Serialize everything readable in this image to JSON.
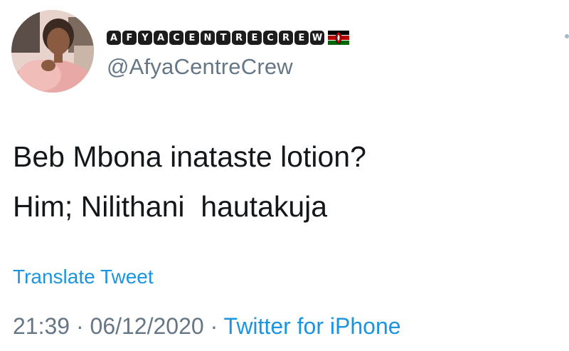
{
  "tweet": {
    "display_name_letters": [
      "A",
      "F",
      "Y",
      "A",
      "C",
      "E",
      "N",
      "T",
      "R",
      "E",
      "C",
      "R",
      "E",
      "W"
    ],
    "flag_icon": "kenya-flag-icon",
    "handle": "@AfyaCentreCrew",
    "lines": [
      "Beb Mbona inataste lotion?",
      "Him; Nilithani  hautakuja"
    ],
    "translate_label": "Translate Tweet",
    "time": "21:39",
    "separator": "·",
    "date": "06/12/2020",
    "source": "Twitter for iPhone"
  },
  "colors": {
    "text": "#14171a",
    "secondary": "#657786",
    "link": "#1b95e0",
    "letter_box": "#1c1c1c"
  }
}
